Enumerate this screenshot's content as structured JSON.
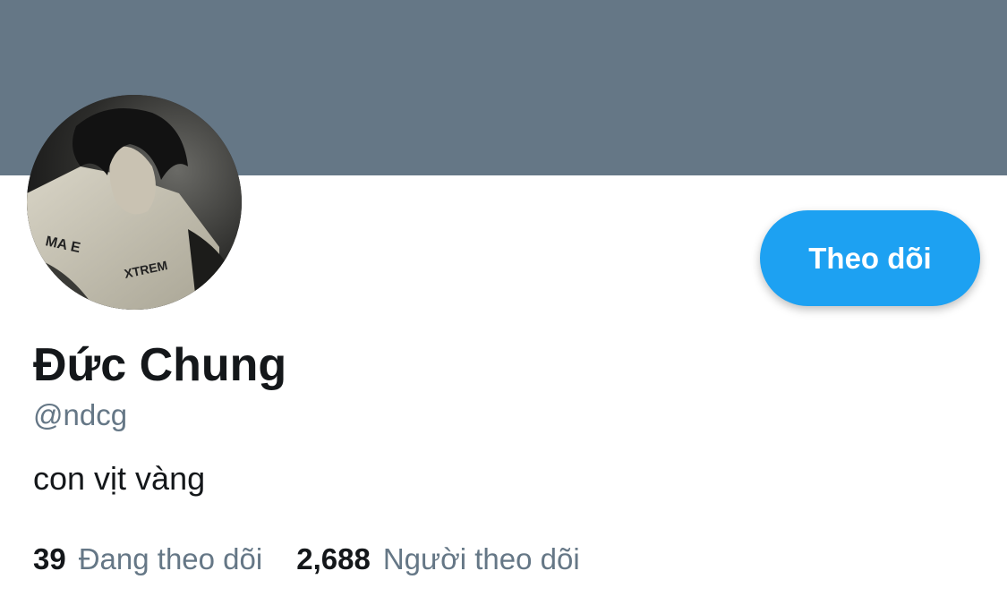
{
  "banner": {
    "color": "#657786"
  },
  "avatar": {
    "description_icon": "profile-photo"
  },
  "follow_button": {
    "label": "Theo dõi",
    "color": "#1da1f2"
  },
  "profile": {
    "display_name": "Đức Chung",
    "handle": "@ndcg",
    "bio": "con vịt vàng"
  },
  "stats": {
    "following": {
      "count": "39",
      "label": "Đang theo dõi"
    },
    "followers": {
      "count": "2,688",
      "label": "Người theo dõi"
    }
  }
}
